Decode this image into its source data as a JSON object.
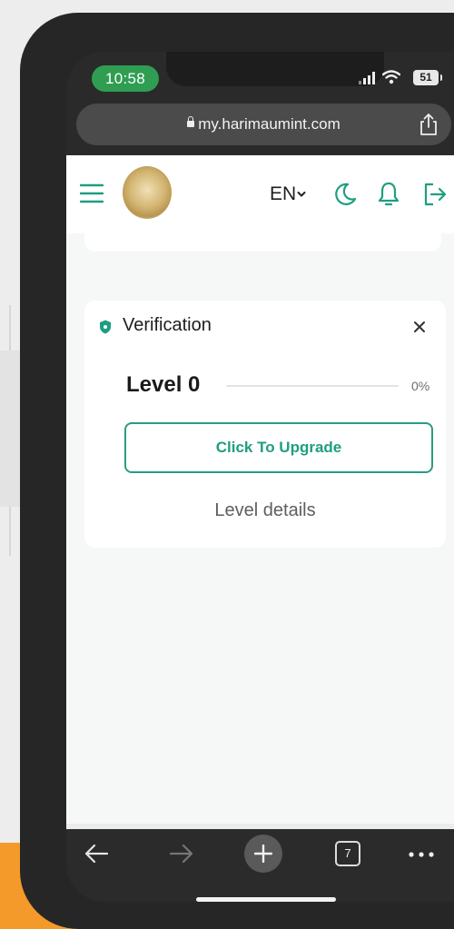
{
  "status_bar": {
    "time": "10:58",
    "battery": "51",
    "icons": [
      "signal-icon",
      "wifi-icon",
      "battery-icon"
    ]
  },
  "browser": {
    "url": "my.harimaumint.com",
    "icons": [
      "lock-icon",
      "share-icon"
    ]
  },
  "header": {
    "language": "EN",
    "icons": [
      "menu-icon",
      "logo",
      "chevron-down-icon",
      "moon-icon",
      "bell-icon",
      "logout-icon"
    ]
  },
  "verification_card": {
    "title": "Verification",
    "level_label": "Level 0",
    "progress_percent": 0,
    "progress_text": "0%",
    "upgrade_button": "Click To Upgrade",
    "level_details_link": "Level details",
    "icons": [
      "shield-icon",
      "close-icon"
    ]
  },
  "toolbar": {
    "tabs_count": "7",
    "icons": [
      "back-arrow-icon",
      "forward-arrow-icon",
      "plus-icon",
      "tabs-icon",
      "more-icon"
    ]
  },
  "colors": {
    "accent": "#21a07d",
    "status_pill": "#2f9e52",
    "backdrop_orange": "#f39a2b"
  }
}
